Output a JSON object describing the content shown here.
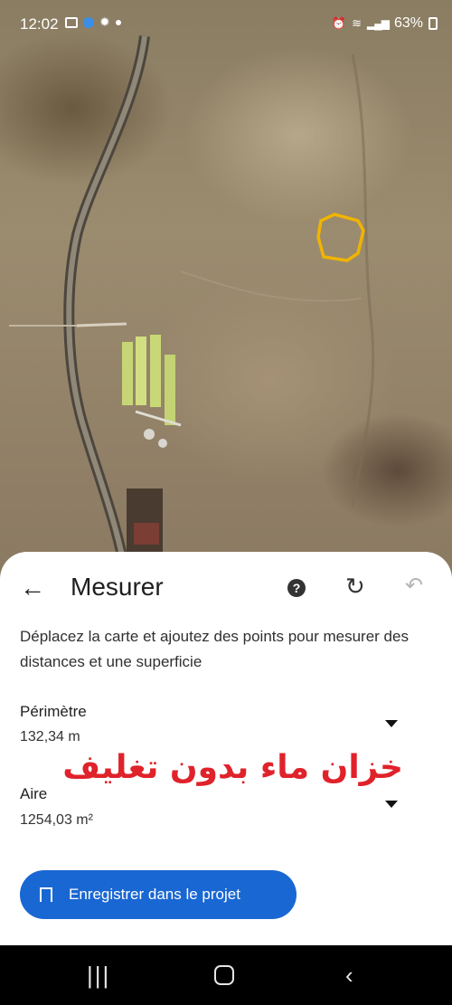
{
  "status_bar": {
    "time": "12:02",
    "battery": "63%"
  },
  "map": {
    "polygon_color": "#f0b400"
  },
  "panel": {
    "title": "Mesurer",
    "help_label": "?",
    "description": "Déplacez la carte et ajoutez des points pour mesurer des distances et une superficie",
    "perimeter_label": "Périmètre",
    "perimeter_value": "132,34 m",
    "area_label": "Aire",
    "area_value": "1254,03 m²",
    "overlay_text": "خزان ماء بدون تغليف",
    "save_button": "Enregistrer dans le projet"
  },
  "colors": {
    "accent": "#1967d2",
    "overlay_text": "#e0222b"
  }
}
